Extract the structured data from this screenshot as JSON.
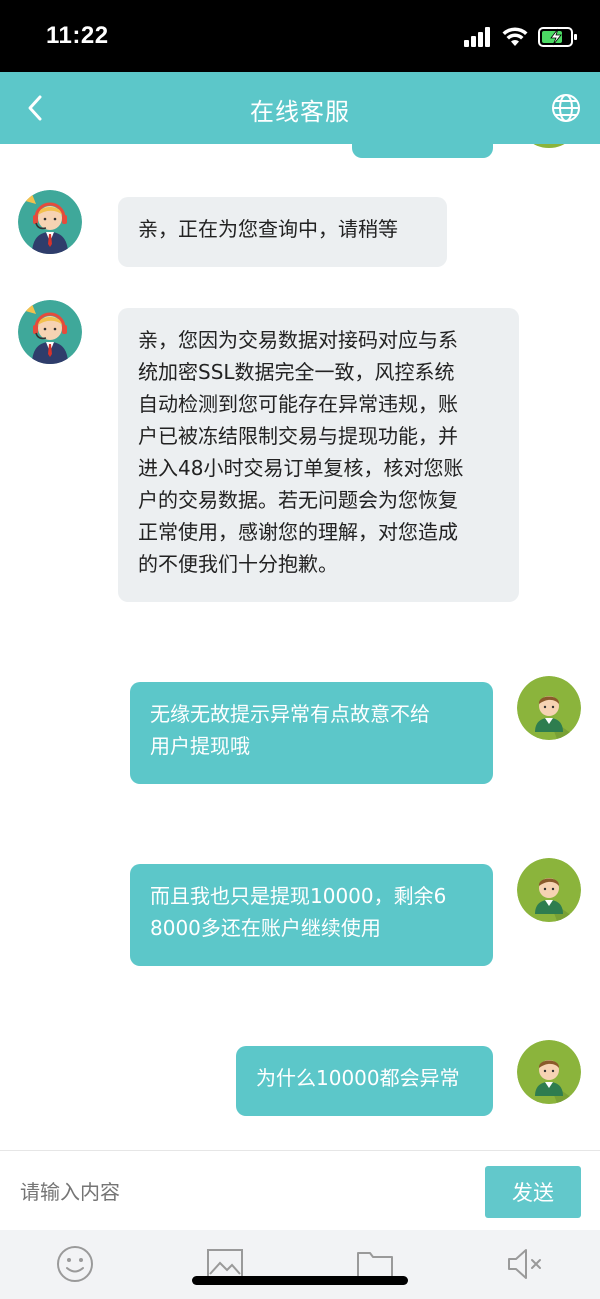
{
  "status_bar": {
    "time": "11:22"
  },
  "header": {
    "title": "在线客服",
    "back_icon": "chevron-left-icon",
    "language_icon": "globe-icon"
  },
  "messages": [
    {
      "from": "agent",
      "text": "亲，正在为您查询中，请稍等"
    },
    {
      "from": "agent",
      "text": "亲，您因为交易数据对接码对应与系\n统加密SSL数据完全一致，风控系统\n自动检测到您可能存在异常违规，账\n户已被冻结限制交易与提现功能，并\n进入48小时交易订单复核，核对您账\n户的交易数据。若无问题会为您恢复\n正常使用，感谢您的理解，对您造成\n的不便我们十分抱歉。"
    },
    {
      "from": "user",
      "text": "无缘无故提示异常有点故意不给\n用户提现哦"
    },
    {
      "from": "user",
      "text": "而且我也只是提现10000，剩余6\n8000多还在账户继续使用"
    },
    {
      "from": "user",
      "text": "为什么10000都会异常"
    }
  ],
  "input": {
    "placeholder": "请输入内容",
    "send_label": "发送"
  },
  "toolbar": {
    "icons": [
      "emoji-icon",
      "image-icon",
      "folder-icon",
      "speaker-mute-icon"
    ]
  },
  "colors": {
    "accent": "#5cc7c9",
    "agent_bubble": "#eceff1",
    "user_bubble": "#5cc7c9",
    "user_avatar_bg": "#8bb43c"
  }
}
